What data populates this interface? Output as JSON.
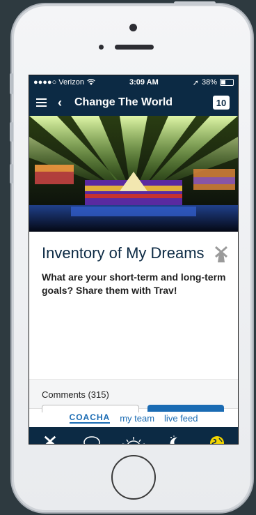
{
  "status": {
    "carrier": "●●●●○ Verizon",
    "time": "3:09 AM",
    "battery": "38%",
    "battery_level": 0.38
  },
  "nav": {
    "title": "Change The World",
    "badge": "10",
    "back_glyph": "‹"
  },
  "card": {
    "title": "Inventory of My Dreams",
    "text": "What are your short-term and long-term goals? Share them with Trav!"
  },
  "comments": {
    "label": "Comments (315)"
  },
  "links": {
    "logo": "COACHA",
    "my_team": "my team",
    "live_feed": "live feed"
  },
  "tabs": [
    {
      "icon": "windmill-icon"
    },
    {
      "icon": "chat-bubble-icon"
    },
    {
      "icon": "sunrise-icon"
    },
    {
      "icon": "moon-icon"
    },
    {
      "icon": "globe-icon"
    }
  ],
  "colors": {
    "navy": "#0c2a44",
    "accent_blue": "#1a6bb3",
    "globe_yellow": "#f2d400"
  }
}
